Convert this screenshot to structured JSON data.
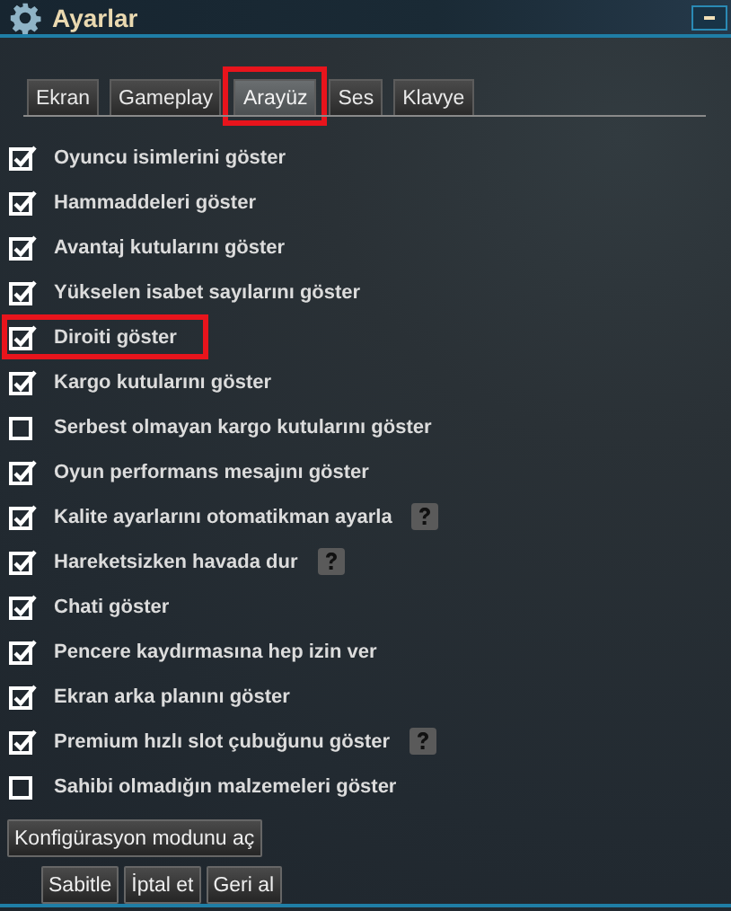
{
  "window": {
    "title": "Ayarlar"
  },
  "tabs": [
    {
      "label": "Ekran",
      "selected": false,
      "highlighted": false
    },
    {
      "label": "Gameplay",
      "selected": false,
      "highlighted": false
    },
    {
      "label": "Arayüz",
      "selected": true,
      "highlighted": true
    },
    {
      "label": "Ses",
      "selected": false,
      "highlighted": false
    },
    {
      "label": "Klavye",
      "selected": false,
      "highlighted": false
    }
  ],
  "options": [
    {
      "label": "Oyuncu isimlerini göster",
      "checked": true,
      "highlighted": false,
      "help": false
    },
    {
      "label": "Hammaddeleri göster",
      "checked": true,
      "highlighted": false,
      "help": false
    },
    {
      "label": "Avantaj kutularını göster",
      "checked": true,
      "highlighted": false,
      "help": false
    },
    {
      "label": "Yükselen isabet sayılarını göster",
      "checked": true,
      "highlighted": false,
      "help": false
    },
    {
      "label": "Diroiti göster",
      "checked": true,
      "highlighted": true,
      "help": false
    },
    {
      "label": "Kargo kutularını göster",
      "checked": true,
      "highlighted": false,
      "help": false
    },
    {
      "label": "Serbest olmayan kargo kutularını göster",
      "checked": false,
      "highlighted": false,
      "help": false
    },
    {
      "label": "Oyun performans mesajını göster",
      "checked": true,
      "highlighted": false,
      "help": false
    },
    {
      "label": "Kalite ayarlarını otomatikman ayarla",
      "checked": true,
      "highlighted": false,
      "help": true
    },
    {
      "label": "Hareketsizken havada dur",
      "checked": true,
      "highlighted": false,
      "help": true
    },
    {
      "label": "Chati göster",
      "checked": true,
      "highlighted": false,
      "help": false
    },
    {
      "label": "Pencere kaydırmasına hep izin ver",
      "checked": true,
      "highlighted": false,
      "help": false
    },
    {
      "label": "Ekran arka planını göster",
      "checked": true,
      "highlighted": false,
      "help": false
    },
    {
      "label": "Premium hızlı slot çubuğunu göster",
      "checked": true,
      "highlighted": false,
      "help": true
    },
    {
      "label": "Sahibi olmadığın malzemeleri göster",
      "checked": false,
      "highlighted": false,
      "help": false
    }
  ],
  "config_button": "Konfigürasyon modunu aç",
  "buttons": [
    "Sabitle",
    "İptal et",
    "Geri al"
  ]
}
